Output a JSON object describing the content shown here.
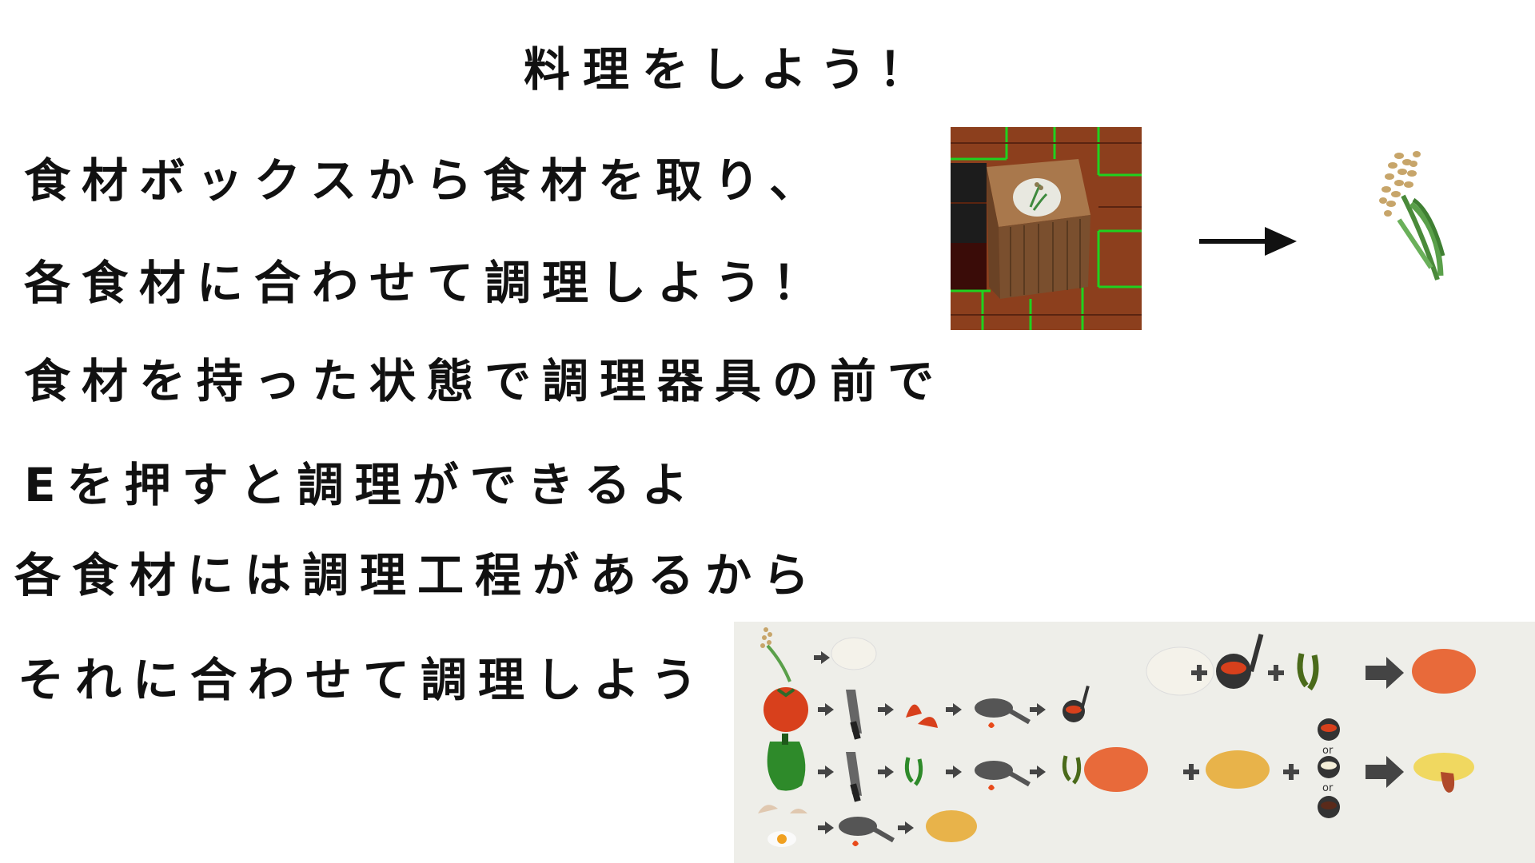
{
  "title": "料理をしよう！",
  "instructions": [
    "食材ボックスから食材を取り、",
    "各食材に合わせて調理しよう！",
    "食材を持った状態で調理器具の前で",
    "Eを押すと調理ができるよ",
    "各食材には調理工程があるから",
    "それに合わせて調理しよう"
  ],
  "icons": {
    "crate": "ingredient-box-icon",
    "arrow": "arrow-right-icon",
    "result": "rice-plant-icon"
  },
  "recipe_panel": {
    "or_label": "or",
    "rows": [
      [
        "rice-plant-icon",
        "cooked-rice-icon"
      ],
      [
        "tomato-icon",
        "knife-icon",
        "chopped-tomato-icon",
        "frying-pan-icon",
        "tomato-sauce-icon"
      ],
      [
        "green-pepper-icon",
        "knife-icon",
        "sliced-pepper-icon",
        "frying-pan-icon",
        "cooked-pepper-icon"
      ],
      [
        "egg-icon",
        "frying-pan-icon",
        "omelette-icon"
      ]
    ],
    "combos": [
      [
        "cooked-rice-icon",
        "tomato-sauce-icon",
        "cooked-pepper-icon",
        "chicken-rice-icon"
      ],
      [
        "chicken-rice-icon",
        "omelette-icon",
        "sauce-choice-icon",
        "omurice-icon"
      ]
    ]
  },
  "colors": {
    "panel": "#eeeee9",
    "tomato": "#d8401c",
    "pepper": "#2e8a2a",
    "egg": "#e8b34a",
    "arrow": "#444444"
  }
}
